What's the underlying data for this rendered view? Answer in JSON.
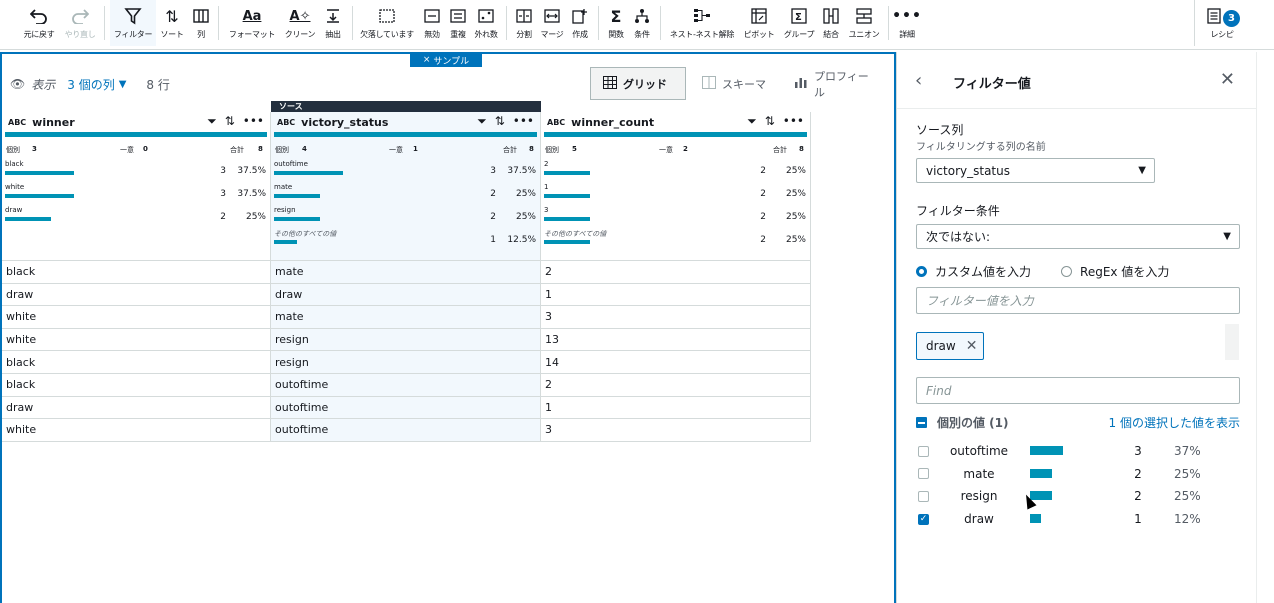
{
  "toolbar": {
    "items": [
      {
        "label": "元に戻す",
        "icon": "undo-icon",
        "disabled": false
      },
      {
        "label": "やり直し",
        "icon": "redo-icon",
        "disabled": true
      },
      {
        "label": "フィルター",
        "icon": "filter-icon",
        "disabled": false,
        "active": true
      },
      {
        "label": "ソート",
        "icon": "sort-icon",
        "disabled": false
      },
      {
        "label": "列",
        "icon": "columns-icon",
        "disabled": false
      },
      {
        "label": "フォーマット",
        "icon": "format-icon",
        "disabled": false
      },
      {
        "label": "クリーン",
        "icon": "clean-icon",
        "disabled": false
      },
      {
        "label": "抽出",
        "icon": "extract-icon",
        "disabled": false
      },
      {
        "label": "欠落しています",
        "icon": "missing-icon",
        "disabled": false
      },
      {
        "label": "無効",
        "icon": "invalid-icon",
        "disabled": false
      },
      {
        "label": "重複",
        "icon": "duplicate-icon",
        "disabled": false
      },
      {
        "label": "外れ数",
        "icon": "outlier-icon",
        "disabled": false
      },
      {
        "label": "分割",
        "icon": "split-icon",
        "disabled": false
      },
      {
        "label": "マージ",
        "icon": "merge-icon",
        "disabled": false
      },
      {
        "label": "作成",
        "icon": "create-icon",
        "disabled": false
      },
      {
        "label": "関数",
        "icon": "function-icon",
        "disabled": false
      },
      {
        "label": "条件",
        "icon": "condition-icon",
        "disabled": false
      },
      {
        "label": "ネスト-ネスト解除",
        "icon": "nest-icon",
        "disabled": false
      },
      {
        "label": "ピボット",
        "icon": "pivot-icon",
        "disabled": false
      },
      {
        "label": "グループ",
        "icon": "group-icon",
        "disabled": false
      },
      {
        "label": "結合",
        "icon": "join-icon",
        "disabled": false
      },
      {
        "label": "ユニオン",
        "icon": "union-icon",
        "disabled": false
      },
      {
        "label": "詳細",
        "icon": "more-icon",
        "disabled": false
      },
      {
        "label": "レシピ",
        "icon": "recipe-icon",
        "disabled": false
      }
    ],
    "recipe_badge": "3"
  },
  "sample_tag": "サンプル",
  "view_bar": {
    "show": "表示",
    "columns": "3 個の列",
    "rows": "8 行"
  },
  "view_tabs": {
    "grid": "グリッド",
    "schema": "スキーマ",
    "profile": "プロフィール"
  },
  "source_banner": "ソース",
  "columns": [
    {
      "type": "ABC",
      "name": "winner",
      "distinct_label": "個別",
      "distinct": "3",
      "unique_label": "一意",
      "unique": "0",
      "total_label": "合計",
      "total": "8",
      "profile": [
        {
          "value": "black",
          "count": "3",
          "pct": "37.5%",
          "ratio": 0.375,
          "italic": false
        },
        {
          "value": "white",
          "count": "3",
          "pct": "37.5%",
          "ratio": 0.375,
          "italic": false
        },
        {
          "value": "draw",
          "count": "2",
          "pct": "25%",
          "ratio": 0.25,
          "italic": false
        }
      ],
      "cells": [
        "black",
        "draw",
        "white",
        "white",
        "black",
        "black",
        "draw",
        "white"
      ]
    },
    {
      "type": "ABC",
      "name": "victory_status",
      "distinct_label": "個別",
      "distinct": "4",
      "unique_label": "一意",
      "unique": "1",
      "total_label": "合計",
      "total": "8",
      "profile": [
        {
          "value": "outoftime",
          "count": "3",
          "pct": "37.5%",
          "ratio": 0.375,
          "italic": false
        },
        {
          "value": "mate",
          "count": "2",
          "pct": "25%",
          "ratio": 0.25,
          "italic": false
        },
        {
          "value": "resign",
          "count": "2",
          "pct": "25%",
          "ratio": 0.25,
          "italic": false
        },
        {
          "value": "その他のすべての値",
          "count": "1",
          "pct": "12.5%",
          "ratio": 0.125,
          "italic": true
        }
      ],
      "cells": [
        "mate",
        "draw",
        "mate",
        "resign",
        "resign",
        "outoftime",
        "outoftime",
        "outoftime"
      ]
    },
    {
      "type": "ABC",
      "name": "winner_count",
      "distinct_label": "個別",
      "distinct": "5",
      "unique_label": "一意",
      "unique": "2",
      "total_label": "合計",
      "total": "8",
      "profile": [
        {
          "value": "2",
          "count": "2",
          "pct": "25%",
          "ratio": 0.25,
          "italic": false
        },
        {
          "value": "1",
          "count": "2",
          "pct": "25%",
          "ratio": 0.25,
          "italic": false
        },
        {
          "value": "3",
          "count": "2",
          "pct": "25%",
          "ratio": 0.25,
          "italic": false
        },
        {
          "value": "その他のすべての値",
          "count": "2",
          "pct": "25%",
          "ratio": 0.25,
          "italic": true
        }
      ],
      "cells": [
        "2",
        "1",
        "3",
        "13",
        "14",
        "2",
        "1",
        "3"
      ]
    }
  ],
  "panel": {
    "title": "フィルター値",
    "source_label": "ソース列",
    "source_sub": "フィルタリングする列の名前",
    "source_value": "victory_status",
    "condition_label": "フィルター条件",
    "condition_value": "次ではない:",
    "radio_custom": "カスタム値を入力",
    "radio_regex": "RegEx 値を入力",
    "value_placeholder": "フィルター値を入力",
    "token": "draw",
    "find_placeholder": "Find",
    "distinct_title": "個別の値 (1)",
    "show_selected": "1 個の選択した値を表示",
    "values": [
      {
        "name": "outoftime",
        "count": "3",
        "pct": "37%",
        "ratio": 0.375,
        "checked": false
      },
      {
        "name": "mate",
        "count": "2",
        "pct": "25%",
        "ratio": 0.25,
        "checked": false
      },
      {
        "name": "resign",
        "count": "2",
        "pct": "25%",
        "ratio": 0.25,
        "checked": false
      },
      {
        "name": "draw",
        "count": "1",
        "pct": "12%",
        "ratio": 0.125,
        "checked": true
      }
    ]
  },
  "colors": {
    "accent": "#0073bb",
    "bar": "#0093b5",
    "banner": "#232f3e"
  }
}
